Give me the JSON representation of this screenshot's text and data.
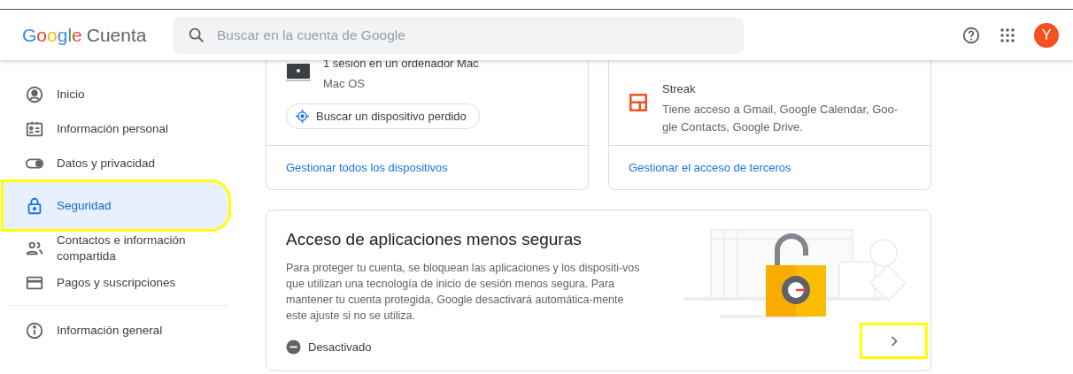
{
  "header": {
    "logo_brand": "Google",
    "logo_product": "Cuenta",
    "search": {
      "placeholder": "Buscar en la cuenta de Google"
    },
    "avatar": "Y"
  },
  "sidebar": {
    "items": [
      {
        "label": "Inicio",
        "selected": false
      },
      {
        "label": "Información personal",
        "selected": false
      },
      {
        "label": "Datos y privacidad",
        "selected": false
      },
      {
        "label": "Seguridad",
        "selected": true
      },
      {
        "label": "Contactos e información compartida",
        "selected": false
      },
      {
        "label": "Pagos y suscripciones",
        "selected": false
      }
    ],
    "footer_items": [
      {
        "label": "Información general",
        "selected": false
      }
    ]
  },
  "devices_card": {
    "device_title": "1 sesión en un ordenador Mac",
    "device_os": "Mac OS",
    "find_button": "Buscar un dispositivo perdido",
    "link": "Gestionar todos los dispositivos"
  },
  "third_party_card": {
    "app_name": "Streak",
    "app_access": "Tiene acceso a Gmail, Google Calendar, Goo-gle Contacts, Google Drive.",
    "link": "Gestionar el acceso de terceros"
  },
  "less_secure_card": {
    "title": "Acceso de aplicaciones menos seguras",
    "description": "Para proteger tu cuenta, se bloquean las aplicaciones y los dispositi-vos que utilizan una tecnología de inicio de sesión menos segura. Para mantener tu cuenta protegida, Google desactivará automática-mente este ajuste si no se utiliza.",
    "status": "Desactivado",
    "enabled": false
  }
}
